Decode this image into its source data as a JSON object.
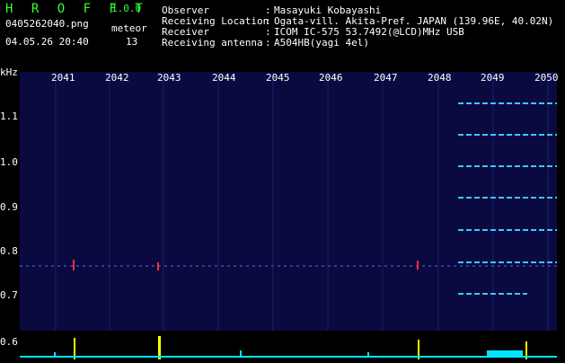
{
  "app": {
    "title": "H R O F F T",
    "version": "1.0.0"
  },
  "file": {
    "name": "0405262040.png",
    "datetime": "04.05.26 20:40"
  },
  "meteor": {
    "label": "meteor",
    "count": "13"
  },
  "info": [
    {
      "key": "Observer",
      "value": "Masayuki Kobayashi"
    },
    {
      "key": "Receiving Location",
      "value": "Ogata-vill. Akita-Pref. JAPAN (139.96E, 40.02N)"
    },
    {
      "key": "Receiver",
      "value": "ICOM IC-575 53.7492(@LCD)MHz USB"
    },
    {
      "key": "Receiving antenna",
      "value": "A504HB(yagi 4el)"
    }
  ],
  "separator": ":",
  "axis": {
    "unit": "kHz",
    "y_ticks": [
      "1.1",
      "1.0",
      "0.9",
      "0.8",
      "0.7",
      "0.6"
    ],
    "x_ticks": [
      "2041",
      "2042",
      "2043",
      "2044",
      "2045",
      "2046",
      "2047",
      "2048",
      "2049",
      "2050"
    ]
  },
  "colors": {
    "title": "#33ff33",
    "background": "#000000",
    "spectrogram": "#0a0a40",
    "signal": "#00e5ff",
    "meteor": "#ffff00"
  }
}
